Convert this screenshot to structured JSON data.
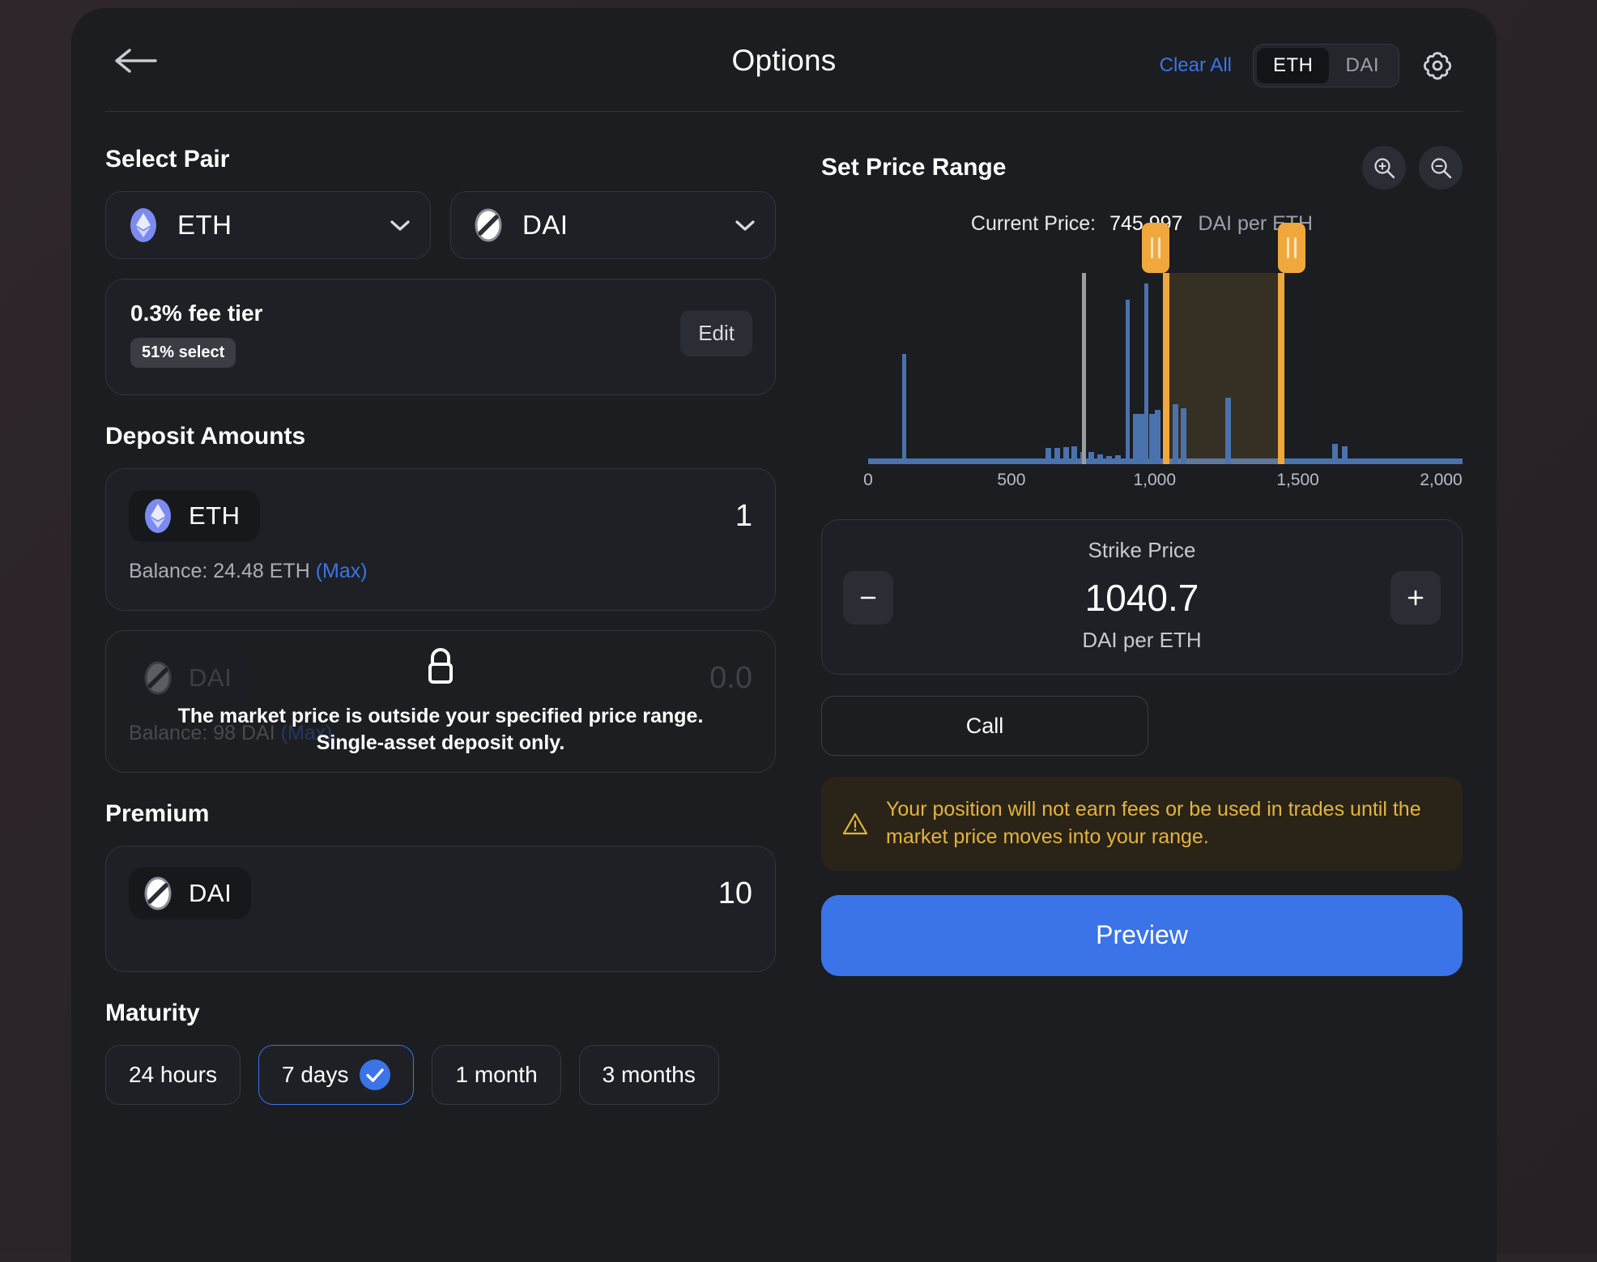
{
  "header": {
    "back_icon": "arrow-left-icon",
    "title": "Options",
    "clear_all": "Clear All",
    "toggle": {
      "options": [
        "ETH",
        "DAI"
      ],
      "selected": "ETH"
    },
    "settings_icon": "gear-icon"
  },
  "select_pair": {
    "title": "Select Pair",
    "base": {
      "symbol": "ETH",
      "icon": "eth-token-icon"
    },
    "quote": {
      "symbol": "DAI",
      "icon": "dai-token-icon"
    }
  },
  "fee_tier": {
    "title": "0.3% fee tier",
    "badge": "51% select",
    "edit_label": "Edit"
  },
  "deposit": {
    "title": "Deposit Amounts",
    "eth": {
      "symbol": "ETH",
      "icon": "eth-token-icon",
      "amount": "1",
      "balance": "Balance: 24.48 ETH",
      "max_label": "(Max)"
    },
    "dai": {
      "symbol": "DAI",
      "icon": "dai-token-icon",
      "amount": "0.0",
      "balance": "Balance: 98 DAI",
      "max_label": "(Max)",
      "lock_icon": "lock-icon",
      "lock_message": "The market price is outside your specified price range. Single-asset deposit only."
    }
  },
  "premium": {
    "title": "Premium",
    "symbol": "DAI",
    "icon": "dai-token-icon",
    "amount": "10"
  },
  "maturity": {
    "title": "Maturity",
    "options": [
      {
        "label": "24 hours",
        "selected": false
      },
      {
        "label": "7 days",
        "selected": true
      },
      {
        "label": "1 month",
        "selected": false
      },
      {
        "label": "3 months",
        "selected": false
      }
    ]
  },
  "price_range": {
    "title": "Set Price Range",
    "zoom_in_icon": "zoom-in-icon",
    "zoom_out_icon": "zoom-out-icon",
    "current_price_label": "Current Price:",
    "current_price_value": "745.997",
    "current_price_unit": "DAI per ETH"
  },
  "strike": {
    "label": "Strike Price",
    "value": "1040.7",
    "unit": "DAI per ETH",
    "decrement_icon": "minus-icon",
    "increment_icon": "plus-icon"
  },
  "call_button": "Call",
  "warning": {
    "icon": "warning-triangle-icon",
    "text": "Your position will not earn fees or be used in trades until the market price moves into your range."
  },
  "preview_button": "Preview",
  "colors": {
    "accent_blue": "#3b74e8",
    "range_orange": "#f0a83c",
    "liquidity_blue": "#4a72ad",
    "warning_yellow": "#e3b43f",
    "card_bg": "#1e2025",
    "panel_bg": "#1b1d21"
  },
  "chart_data": {
    "type": "bar",
    "title": "",
    "xlabel": "",
    "ylabel": "",
    "xlim": [
      0,
      2075
    ],
    "ylim": [
      0,
      100
    ],
    "grid": false,
    "legend": false,
    "tick_labels": [
      "0",
      "500",
      "1,000",
      "1,500",
      "2,000"
    ],
    "ticks": [
      0,
      500,
      1000,
      1500,
      2000
    ],
    "current_price_marker": 745.997,
    "range_min": 1040.7,
    "range_max": 1443,
    "baseline_value": 2,
    "bars": [
      {
        "x": 120,
        "value": 55
      },
      {
        "x": 620,
        "value": 8
      },
      {
        "x": 650,
        "value": 8
      },
      {
        "x": 680,
        "value": 8.5
      },
      {
        "x": 710,
        "value": 9
      },
      {
        "x": 740,
        "value": 6
      },
      {
        "x": 770,
        "value": 6
      },
      {
        "x": 800,
        "value": 5
      },
      {
        "x": 830,
        "value": 4
      },
      {
        "x": 862,
        "value": 4.5
      },
      {
        "x": 900,
        "value": 82
      },
      {
        "x": 925,
        "value": 25
      },
      {
        "x": 945,
        "value": 25
      },
      {
        "x": 963,
        "value": 90
      },
      {
        "x": 982,
        "value": 25
      },
      {
        "x": 1000,
        "value": 27
      },
      {
        "x": 1062,
        "value": 30
      },
      {
        "x": 1090,
        "value": 28
      },
      {
        "x": 1248,
        "value": 33
      },
      {
        "x": 1620,
        "value": 10
      },
      {
        "x": 1655,
        "value": 9
      }
    ]
  }
}
